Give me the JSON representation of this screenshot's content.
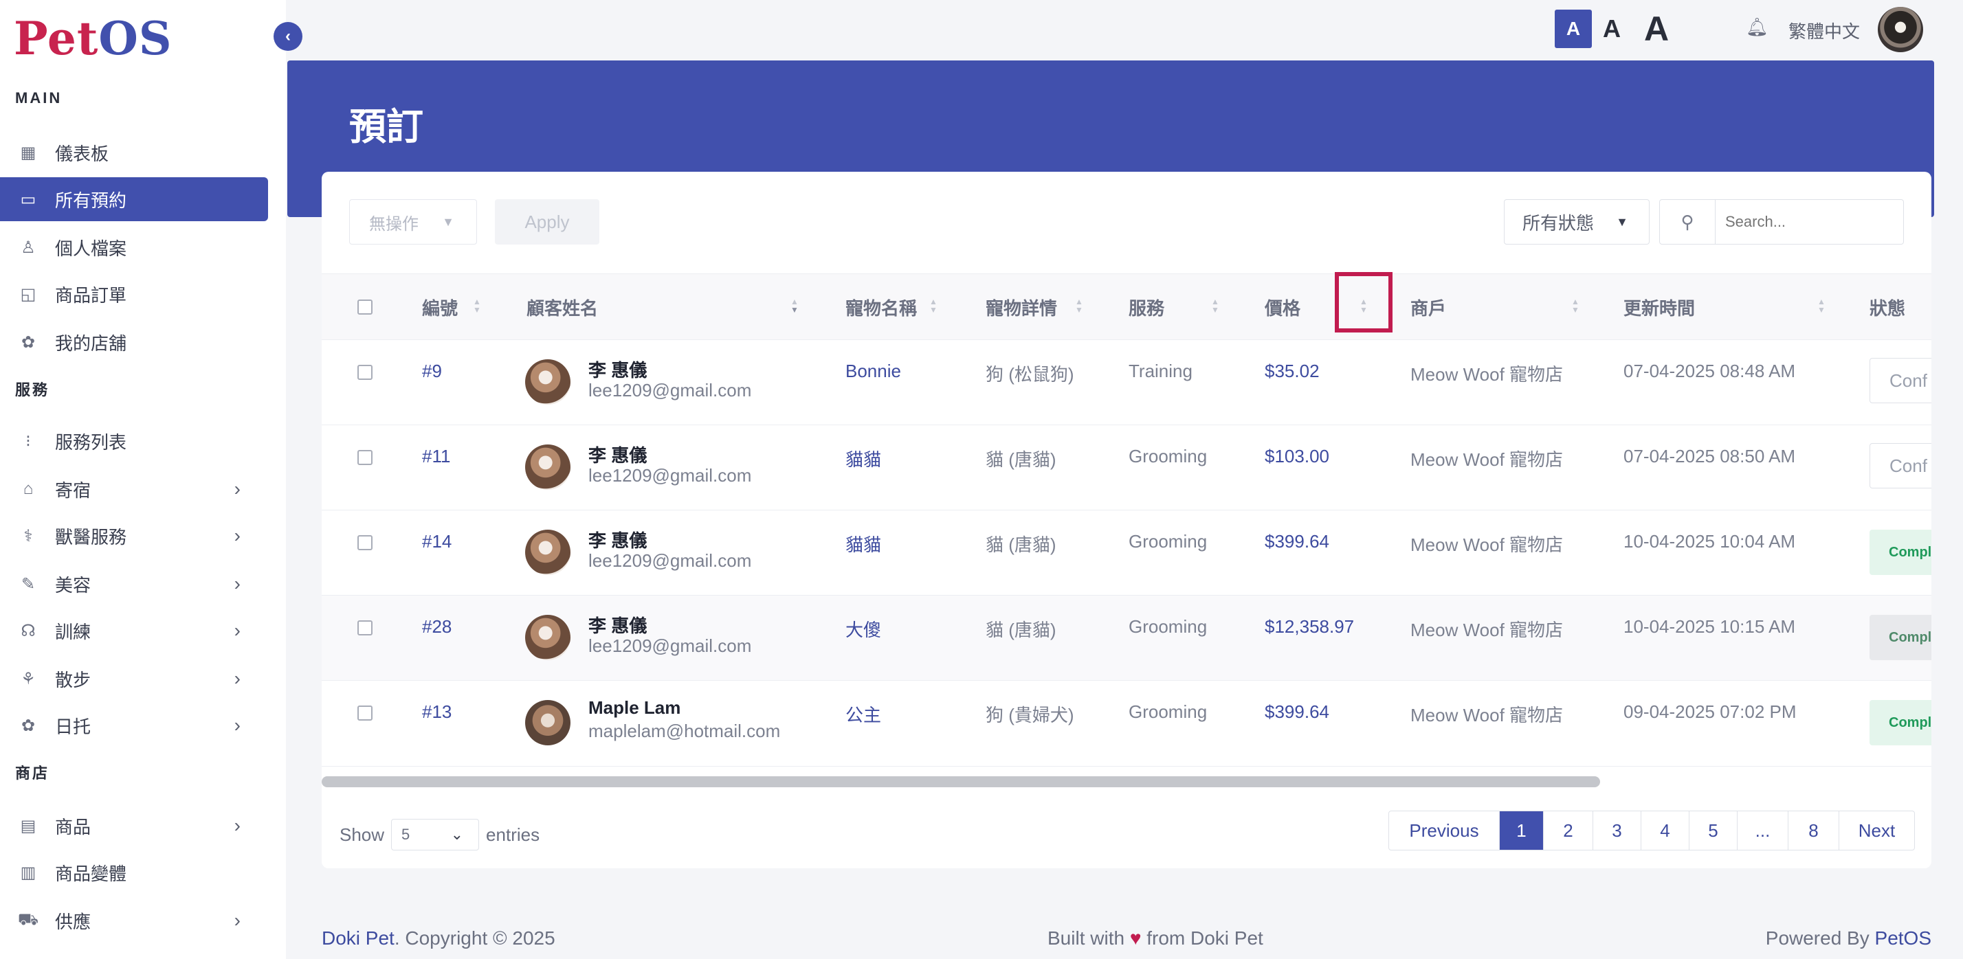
{
  "app": {
    "logo_pet": "Pet",
    "logo_os": "OS"
  },
  "sidebar": {
    "sections": [
      {
        "label": "MAIN"
      },
      {
        "label": "服務"
      },
      {
        "label": "商店"
      }
    ],
    "items": [
      {
        "label": "儀表板",
        "icon": "grid-icon"
      },
      {
        "label": "所有預約",
        "icon": "calendar-icon",
        "active": true
      },
      {
        "label": "個人檔案",
        "icon": "user-icon"
      },
      {
        "label": "商品訂單",
        "icon": "bag-icon"
      },
      {
        "label": "我的店舖",
        "icon": "store-icon"
      },
      {
        "label": "服務列表",
        "icon": "list-icon"
      },
      {
        "label": "寄宿",
        "icon": "home-icon"
      },
      {
        "label": "獸醫服務",
        "icon": "vet-icon"
      },
      {
        "label": "美容",
        "icon": "brush-icon"
      },
      {
        "label": "訓練",
        "icon": "training-icon"
      },
      {
        "label": "散步",
        "icon": "walk-icon"
      },
      {
        "label": "日托",
        "icon": "daycare-icon"
      },
      {
        "label": "商品",
        "icon": "shop-icon"
      },
      {
        "label": "商品變體",
        "icon": "variant-icon"
      },
      {
        "label": "供應",
        "icon": "truck-icon"
      }
    ]
  },
  "topbar": {
    "font_small": "A",
    "font_medium": "A",
    "font_large": "A",
    "language": "繁體中文"
  },
  "page": {
    "title": "預訂"
  },
  "toolbar": {
    "bulk_action": "無操作",
    "apply_label": "Apply",
    "status_filter": "所有狀態",
    "search_placeholder": "Search..."
  },
  "table": {
    "columns": [
      "編號",
      "顧客姓名",
      "寵物名稱",
      "寵物詳情",
      "服務",
      "價格",
      "商戶",
      "更新時間",
      "狀態"
    ],
    "rows": [
      {
        "id": "#9",
        "name": "李 惠儀",
        "email": "lee1209@gmail.com",
        "pet": "Bonnie",
        "detail": "狗 (松鼠狗)",
        "service": "Training",
        "price": "$35.02",
        "merchant": "Meow Woof 寵物店",
        "updated": "07-04-2025 08:48 AM",
        "status": "Conf"
      },
      {
        "id": "#11",
        "name": "李 惠儀",
        "email": "lee1209@gmail.com",
        "pet": "貓貓",
        "detail": "貓 (唐貓)",
        "service": "Grooming",
        "price": "$103.00",
        "merchant": "Meow Woof 寵物店",
        "updated": "07-04-2025 08:50 AM",
        "status": "Conf"
      },
      {
        "id": "#14",
        "name": "李 惠儀",
        "email": "lee1209@gmail.com",
        "pet": "貓貓",
        "detail": "貓 (唐貓)",
        "service": "Grooming",
        "price": "$399.64",
        "merchant": "Meow Woof 寵物店",
        "updated": "10-04-2025 10:04 AM",
        "status": "Compl"
      },
      {
        "id": "#28",
        "name": "李 惠儀",
        "email": "lee1209@gmail.com",
        "pet": "大傻",
        "detail": "貓 (唐貓)",
        "service": "Grooming",
        "price": "$12,358.97",
        "merchant": "Meow Woof 寵物店",
        "updated": "10-04-2025 10:15 AM",
        "status": "Compl"
      },
      {
        "id": "#13",
        "name": "Maple Lam",
        "email": "maplelam@hotmail.com",
        "pet": "公主",
        "detail": "狗 (貴婦犬)",
        "service": "Grooming",
        "price": "$399.64",
        "merchant": "Meow Woof 寵物店",
        "updated": "09-04-2025 07:02 PM",
        "status": "Compl"
      }
    ]
  },
  "length": {
    "show": "Show",
    "value": "5",
    "entries": "entries"
  },
  "pagination": {
    "previous": "Previous",
    "pages": [
      "1",
      "2",
      "3",
      "4",
      "5",
      "...",
      "8"
    ],
    "next": "Next"
  },
  "footer": {
    "brand": "Doki Pet",
    "copyright": ". Copyright © 2025",
    "built_pre": "Built with ",
    "heart": "♥",
    "built_post": " from Doki Pet",
    "powered_pre": "Powered By ",
    "powered_brand": "PetOS"
  },
  "colors": {
    "primary": "#4150ad",
    "highlight": "#c11c4f",
    "logo_red": "#c8234e"
  }
}
